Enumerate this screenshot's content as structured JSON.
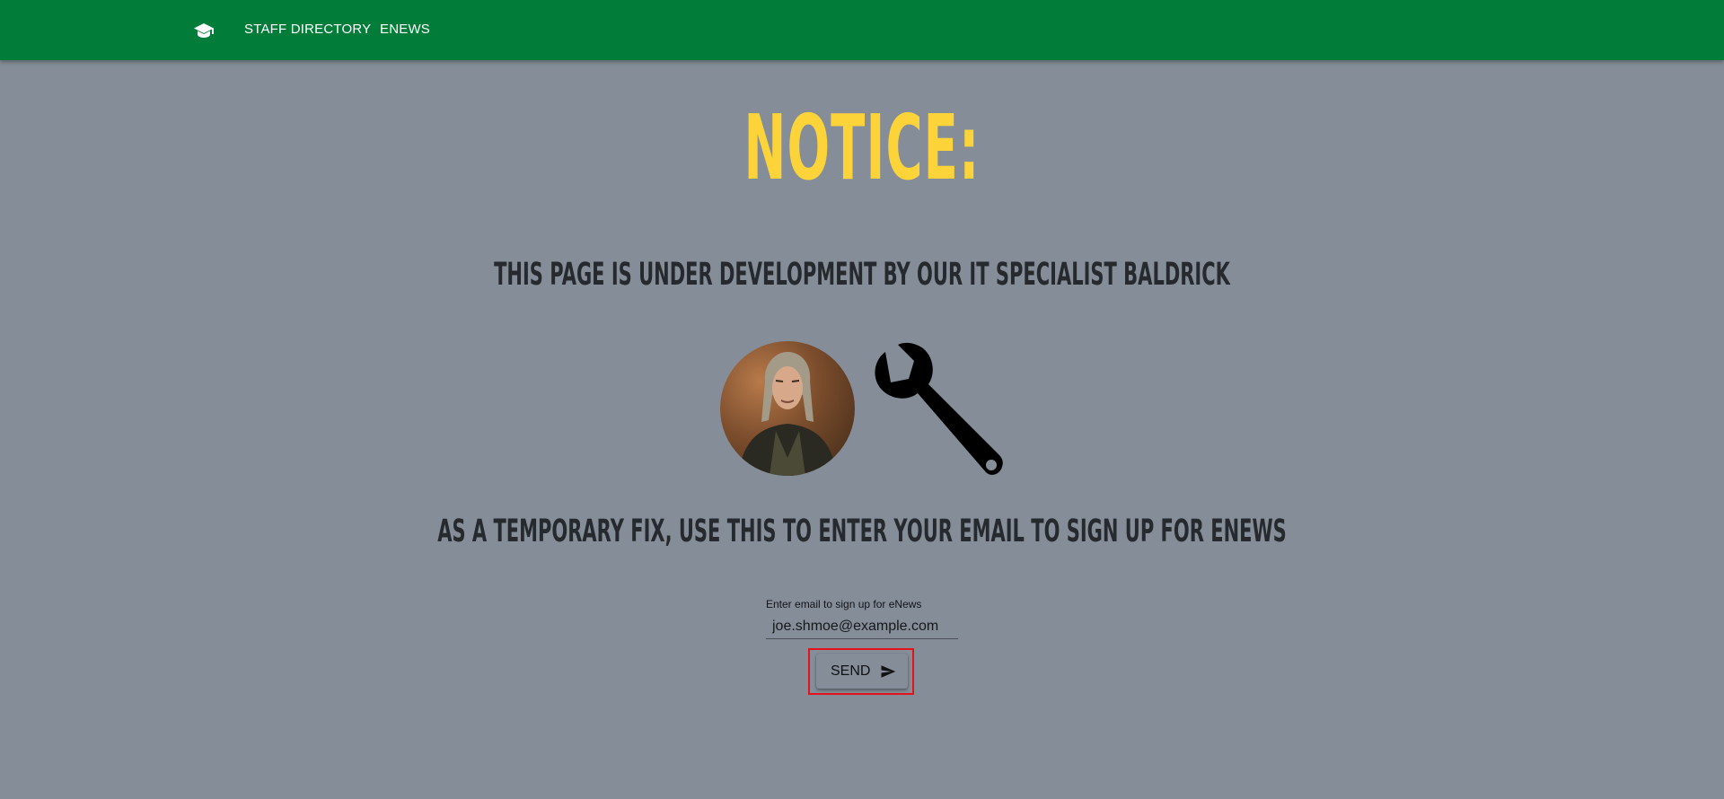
{
  "nav": {
    "logo_icon": "graduation-cap-icon",
    "links": [
      {
        "label": "STAFF DIRECTORY"
      },
      {
        "label": "ENEWS"
      }
    ]
  },
  "main": {
    "notice_title": "NOTICE:",
    "development_message": "THIS PAGE IS UNDER DEVELOPMENT BY OUR IT SPECIALIST BALDRICK",
    "avatar_icon": "person-photo",
    "wrench_icon": "wrench-icon",
    "temporary_fix_message": "AS A TEMPORARY FIX, USE THIS TO ENTER YOUR EMAIL TO SIGN UP FOR ENEWS"
  },
  "form": {
    "email_label": "Enter email to sign up for eNews",
    "email_value": "joe.shmoe@example.com",
    "send_label": "SEND",
    "send_icon": "send-icon"
  },
  "colors": {
    "navbar": "#017d39",
    "background": "#858e98",
    "notice": "#fdd33a",
    "headline": "#262a2e",
    "highlight": "#e3131b"
  }
}
